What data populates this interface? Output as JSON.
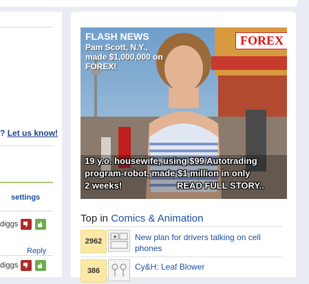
{
  "left": {
    "feedback_prefix": "?",
    "feedback_link": "Let us know!",
    "settings_label": "settings",
    "comments": [
      {
        "diggs_label": "diggs",
        "reply_label": "Reply"
      },
      {
        "diggs_label": "diggs"
      }
    ]
  },
  "ad": {
    "headline": "FLASH NEWS",
    "subline": "Pam Scott, N.Y., made $1,000,000 on FOREX!",
    "brand": "FOREX",
    "banner_lines": [
      "19 y.o. housewife, using $99 Autotrading",
      "program-robot, made $1 million in only",
      "2 weeks!"
    ],
    "cta": "READ FULL STORY..",
    "colors": {
      "brand_red": "#e01212"
    }
  },
  "top": {
    "prefix": "Top in",
    "category": "Comics & Animation",
    "stories": [
      {
        "count": "2962",
        "title": "New plan for drivers talking on cell phones"
      },
      {
        "count": "386",
        "title": "Cy&H: Leaf Blower"
      }
    ]
  },
  "colors": {
    "page_bg": "#e9edf3",
    "link_blue": "#1a4f9e",
    "bury_red": "#b02a2a",
    "digg_green": "#6cae4b",
    "count_bg": "#fbe8a6"
  }
}
